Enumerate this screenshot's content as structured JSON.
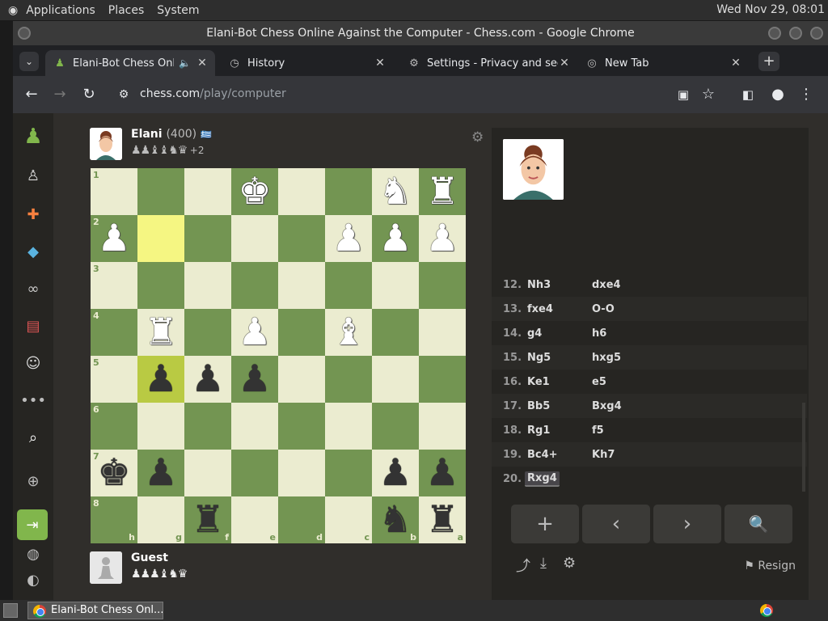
{
  "desktop": {
    "menu": [
      "Applications",
      "Places",
      "System"
    ],
    "clock": "Wed Nov 29, 08:01"
  },
  "window": {
    "title": "Elani-Bot Chess Online Against the Computer - Chess.com - Google Chrome"
  },
  "tabs": [
    {
      "label": "Elani-Bot Chess Online Against the Computer",
      "icon": "chess-pawn-icon",
      "active": true
    },
    {
      "label": "History",
      "icon": "history-icon",
      "active": false
    },
    {
      "label": "Settings - Privacy and security",
      "icon": "gear-icon",
      "active": false
    },
    {
      "label": "New Tab",
      "icon": "chrome-icon",
      "active": false
    }
  ],
  "address": {
    "host": "chess.com",
    "path": "/play/computer"
  },
  "opponent": {
    "name": "Elani",
    "rating": "(400)",
    "flag": "🇬🇷",
    "captured": "♟♟♝♝♞♛",
    "advantage": "+2"
  },
  "player": {
    "name": "Guest",
    "captured": "♟♟♟♝♞♛"
  },
  "board": {
    "ranks": [
      "1",
      "2",
      "3",
      "4",
      "5",
      "6",
      "7",
      "8"
    ],
    "files": [
      "h",
      "g",
      "f",
      "e",
      "d",
      "c",
      "b",
      "a"
    ],
    "rows": [
      [
        "",
        "",
        "",
        "wK",
        "",
        "",
        "wN",
        "wR"
      ],
      [
        "wP",
        "",
        "",
        "",
        "",
        "wP",
        "wP",
        "wP"
      ],
      [
        "",
        "",
        "",
        "",
        "",
        "",
        "",
        ""
      ],
      [
        "",
        "wR",
        "",
        "wP",
        "",
        "wB",
        "",
        ""
      ],
      [
        "",
        "bP",
        "bP",
        "bP",
        "",
        "",
        "",
        ""
      ],
      [
        "",
        "",
        "",
        "",
        "",
        "",
        "",
        ""
      ],
      [
        "bK",
        "bP",
        "",
        "",
        "",
        "",
        "bP",
        "bP"
      ],
      [
        "",
        "",
        "bR",
        "",
        "",
        "",
        "bN",
        "bR"
      ]
    ],
    "highlight": [
      "1-1",
      "4-1"
    ]
  },
  "moves": [
    {
      "n": "12.",
      "w": "Nh3",
      "b": "dxe4"
    },
    {
      "n": "13.",
      "w": "fxe4",
      "b": "O-O"
    },
    {
      "n": "14.",
      "w": "g4",
      "b": "h6"
    },
    {
      "n": "15.",
      "w": "Ng5",
      "b": "hxg5"
    },
    {
      "n": "16.",
      "w": "Ke1",
      "b": "e5"
    },
    {
      "n": "17.",
      "w": "Bb5",
      "b": "Bxg4"
    },
    {
      "n": "18.",
      "w": "Rg1",
      "b": "f5"
    },
    {
      "n": "19.",
      "w": "Bc4+",
      "b": "Kh7"
    },
    {
      "n": "20.",
      "w": "Rxg4",
      "b": ""
    }
  ],
  "controls": {
    "add": "+",
    "prev": "‹",
    "next": "›",
    "analyze": "🔍"
  },
  "actions": {
    "resign": "Resign"
  },
  "taskbar": {
    "item": "Elani-Bot Chess Onl..."
  }
}
